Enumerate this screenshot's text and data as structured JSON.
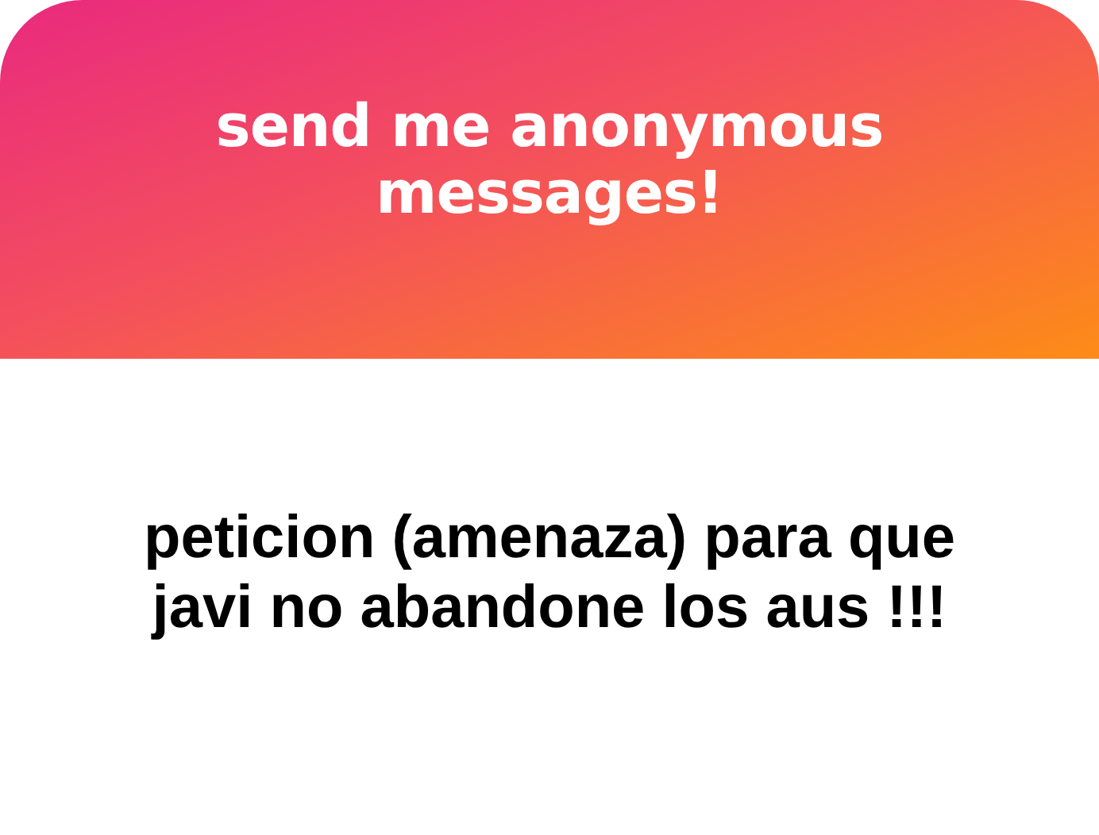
{
  "header": {
    "title": "send me anonymous messages!"
  },
  "message": {
    "text": "peticion (amenaza) para que javi no abandone los aus !!!"
  }
}
